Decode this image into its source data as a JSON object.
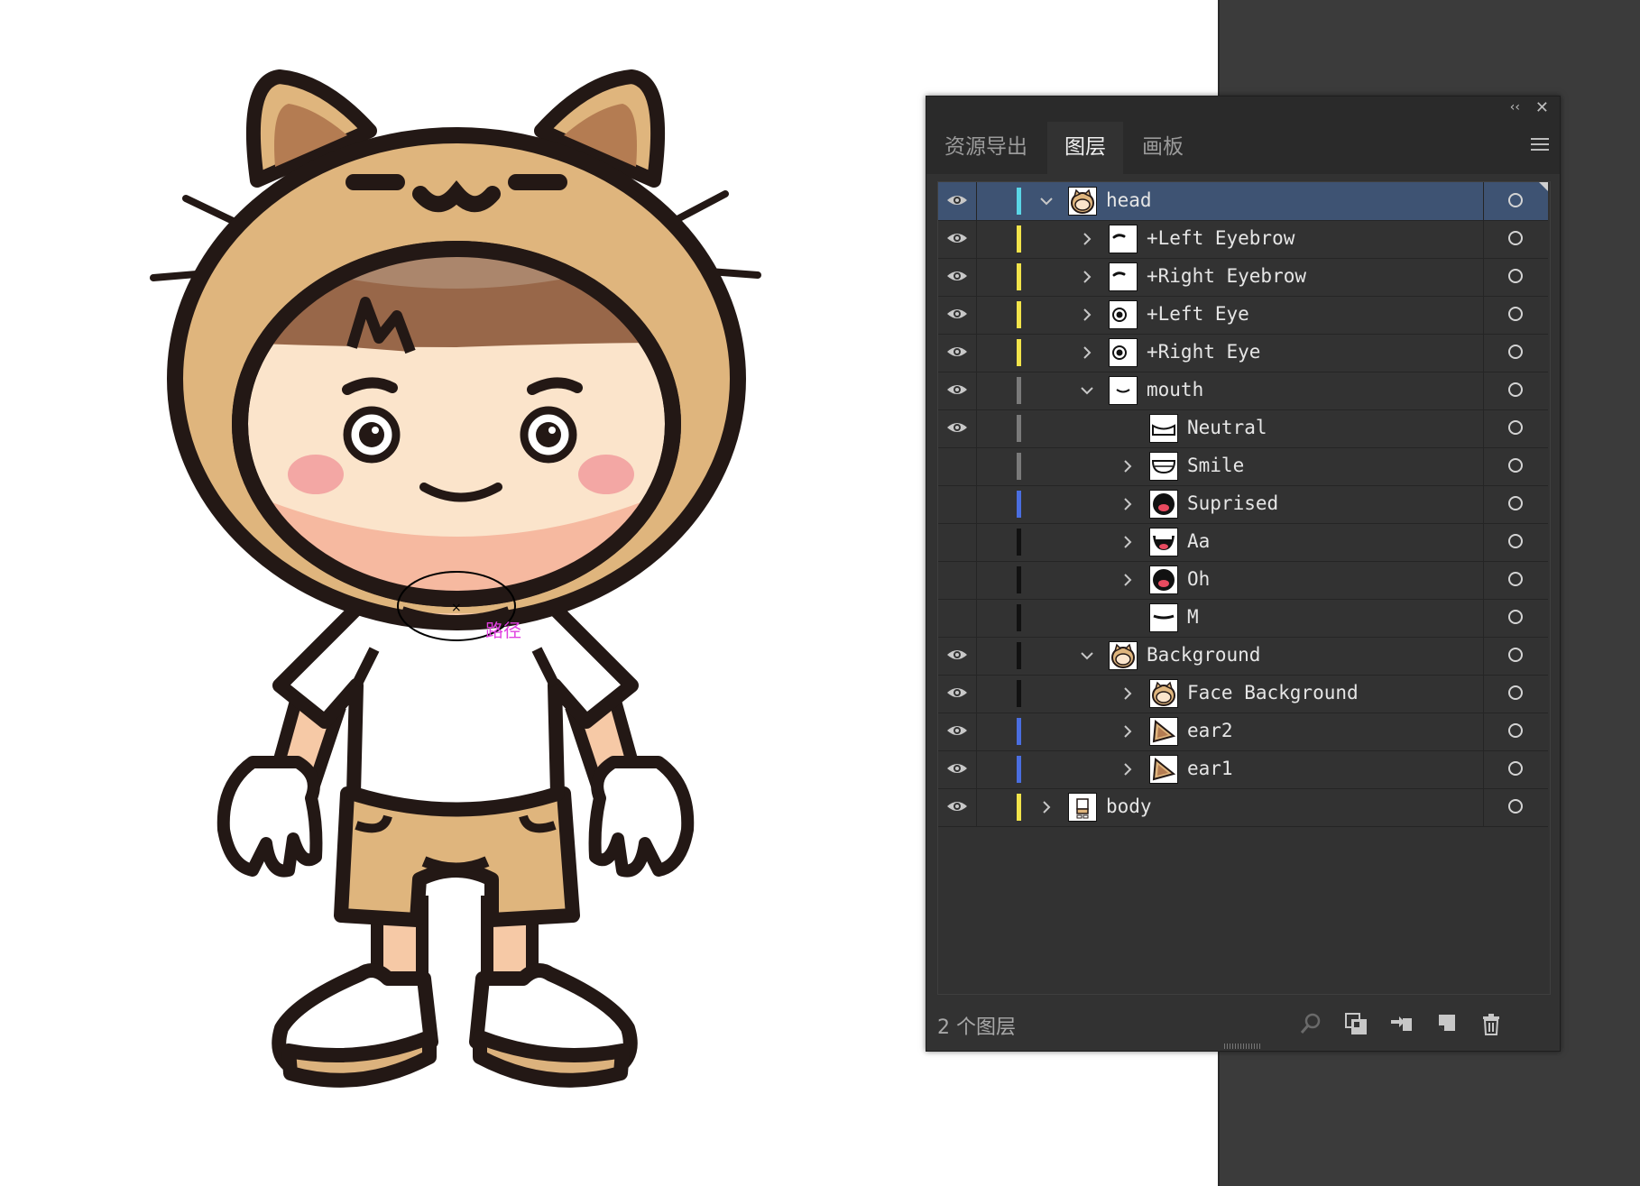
{
  "canvas": {
    "path_label": "路径"
  },
  "panel": {
    "tabs": [
      {
        "label": "资源导出",
        "active": false
      },
      {
        "label": "图层",
        "active": true
      },
      {
        "label": "画板",
        "active": false
      }
    ],
    "collapse_glyph": "‹‹",
    "close_glyph": "✕",
    "footer": {
      "layer_count": "2 个图层",
      "buttons": [
        "search-icon",
        "clip-mask-icon",
        "move-to-layer-icon",
        "new-layer-icon",
        "trash-icon"
      ]
    },
    "colors": {
      "selected_row": "#3e5373",
      "panel_bg": "#323232",
      "cyan": "#5ad6e6",
      "yellow": "#f2e44a",
      "blue": "#4a6ee0",
      "gray": "#7a7a7a",
      "black": "#111111"
    },
    "layers": [
      {
        "name": "head",
        "visible": true,
        "color": "#5ad6e6",
        "expand": "open",
        "indent": 0,
        "thumb": "cat-head",
        "selected": true
      },
      {
        "name": "+Left Eyebrow",
        "visible": true,
        "color": "#f2e44a",
        "expand": "closed",
        "indent": 1,
        "thumb": "eyebrow"
      },
      {
        "name": "+Right Eyebrow",
        "visible": true,
        "color": "#f2e44a",
        "expand": "closed",
        "indent": 1,
        "thumb": "eyebrow"
      },
      {
        "name": "+Left Eye",
        "visible": true,
        "color": "#f2e44a",
        "expand": "closed",
        "indent": 1,
        "thumb": "eye"
      },
      {
        "name": "+Right Eye",
        "visible": true,
        "color": "#f2e44a",
        "expand": "closed",
        "indent": 1,
        "thumb": "eye"
      },
      {
        "name": "mouth",
        "visible": true,
        "color": "#7a7a7a",
        "expand": "open",
        "indent": 1,
        "thumb": "mouth-line"
      },
      {
        "name": "Neutral",
        "visible": true,
        "color": "#7a7a7a",
        "expand": "none",
        "indent": 2,
        "thumb": "mouth-neutral"
      },
      {
        "name": "Smile",
        "visible": false,
        "color": "#7a7a7a",
        "expand": "closed",
        "indent": 2,
        "thumb": "mouth-smile"
      },
      {
        "name": "Suprised",
        "visible": false,
        "color": "#4a6ee0",
        "expand": "closed",
        "indent": 2,
        "thumb": "mouth-open"
      },
      {
        "name": "Aa",
        "visible": false,
        "color": "#111111",
        "expand": "closed",
        "indent": 2,
        "thumb": "mouth-aa"
      },
      {
        "name": "Oh",
        "visible": false,
        "color": "#111111",
        "expand": "closed",
        "indent": 2,
        "thumb": "mouth-open"
      },
      {
        "name": "M",
        "visible": false,
        "color": "#111111",
        "expand": "none",
        "indent": 2,
        "thumb": "mouth-m"
      },
      {
        "name": "Background",
        "visible": true,
        "color": "#111111",
        "expand": "open",
        "indent": 1,
        "thumb": "cat-head"
      },
      {
        "name": "Face Background",
        "visible": true,
        "color": "#111111",
        "expand": "closed",
        "indent": 2,
        "thumb": "cat-head"
      },
      {
        "name": "ear2",
        "visible": true,
        "color": "#4a6ee0",
        "expand": "closed",
        "indent": 2,
        "thumb": "ear"
      },
      {
        "name": "ear1",
        "visible": true,
        "color": "#4a6ee0",
        "expand": "closed",
        "indent": 2,
        "thumb": "ear"
      },
      {
        "name": "body",
        "visible": true,
        "color": "#f2e44a",
        "expand": "closed",
        "indent": 0,
        "thumb": "body"
      }
    ]
  }
}
